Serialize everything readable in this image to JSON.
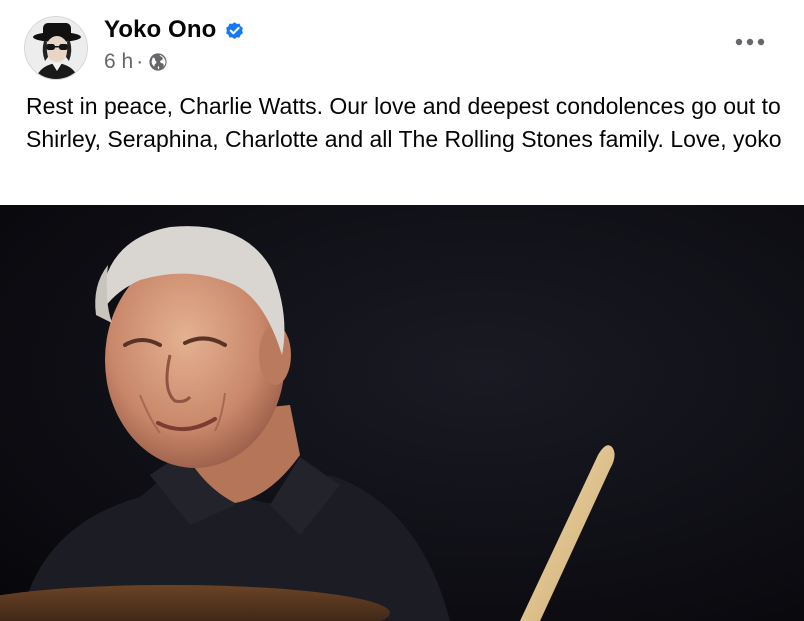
{
  "post": {
    "author": {
      "name": "Yoko Ono",
      "verified": true,
      "avatar_icon": "profile-photo"
    },
    "timestamp": "6 h",
    "separator": "·",
    "audience_icon": "globe-icon",
    "more_icon": "ellipsis-icon",
    "text": "Rest in peace, Charlie Watts. Our love and deepest condolences go out to Shirley, Seraphina, Charlotte and all The Rolling Stones family. Love, yoko",
    "image": {
      "subject": "drummer-photo"
    }
  },
  "colors": {
    "verified_blue": "#1877f2",
    "secondary_text": "#65676b",
    "primary_text": "#050505",
    "photo_background": "#0b0b10"
  }
}
